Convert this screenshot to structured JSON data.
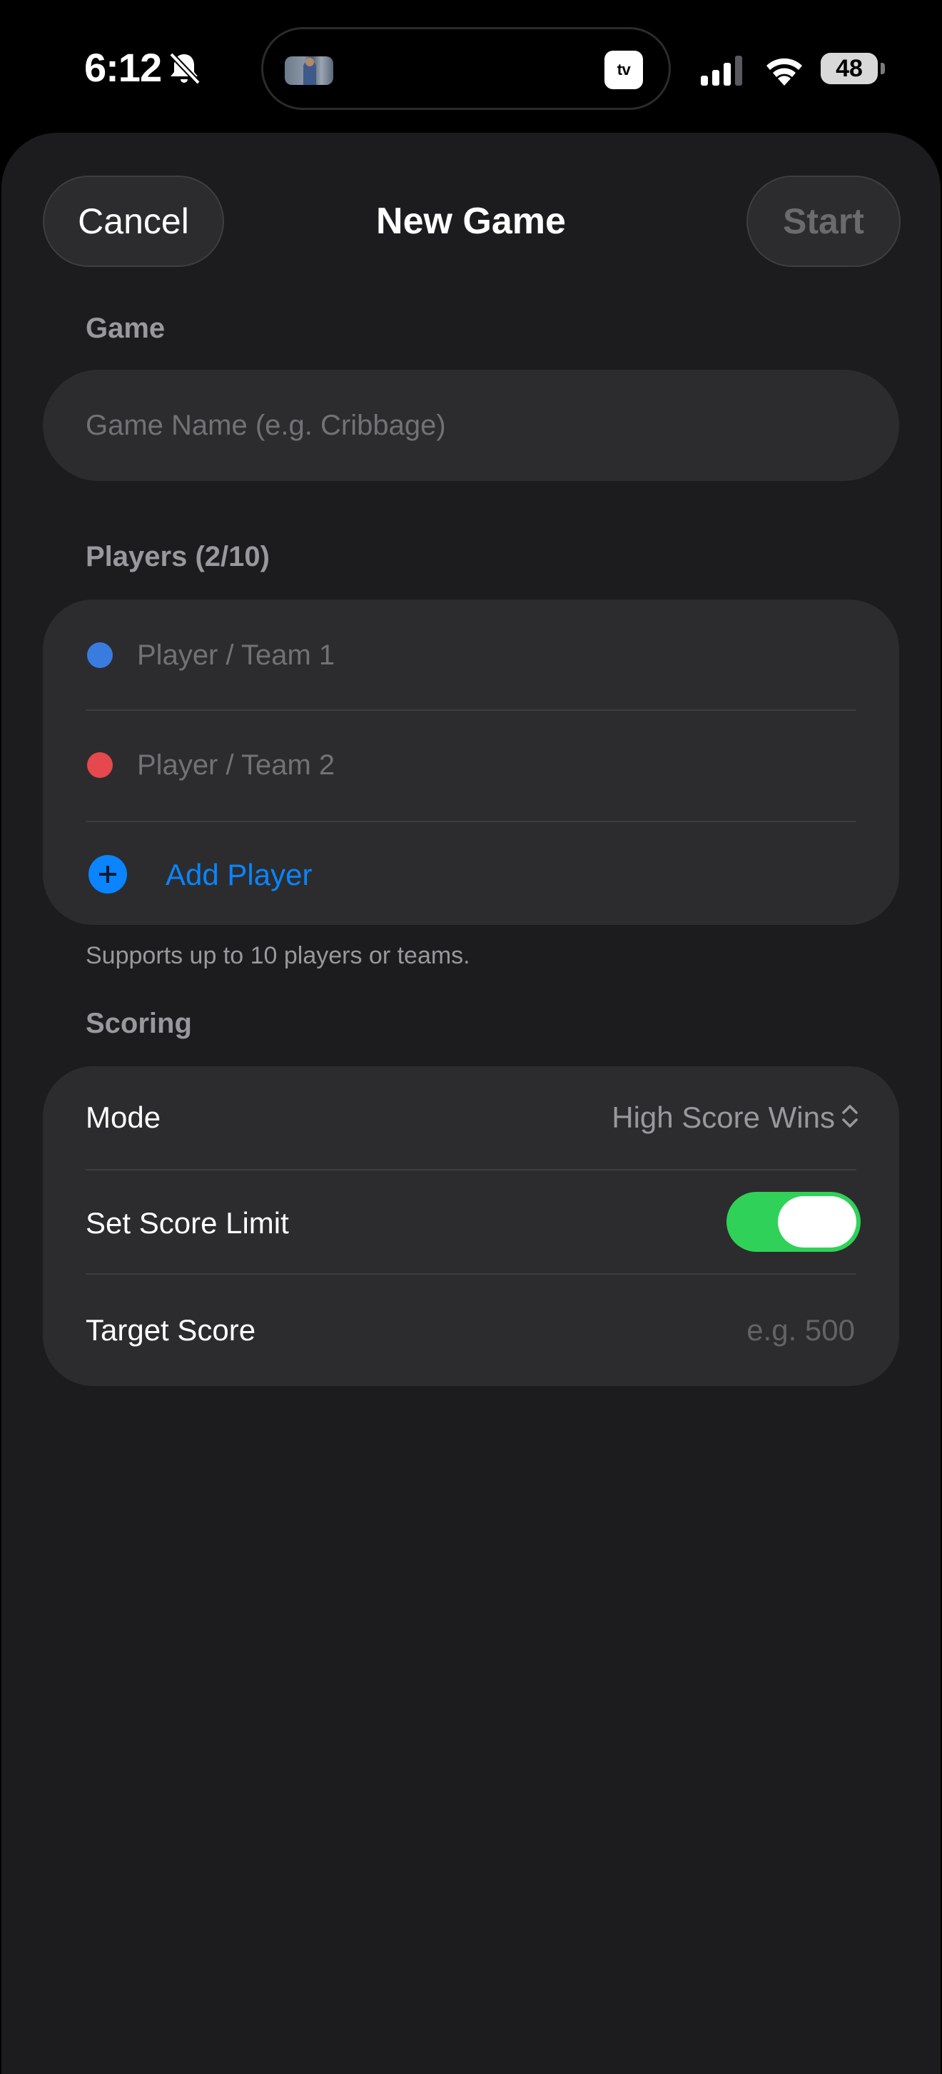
{
  "status_bar": {
    "time": "6:12",
    "battery_level": "48",
    "tv_badge": "tv",
    "icons": [
      "bell-slash-icon",
      "apple-tv-icon",
      "cellular-signal-icon",
      "wifi-icon",
      "battery-icon"
    ]
  },
  "nav": {
    "cancel_label": "Cancel",
    "title": "New Game",
    "start_label": "Start"
  },
  "game_section": {
    "header": "Game",
    "name_placeholder": "Game Name (e.g. Cribbage)"
  },
  "players_section": {
    "header": "Players (2/10)",
    "players": [
      {
        "placeholder": "Player / Team 1",
        "color": "#3a7be0"
      },
      {
        "placeholder": "Player / Team 2",
        "color": "#e5484d"
      }
    ],
    "add_label": "Add Player",
    "footnote": "Supports up to 10 players or teams."
  },
  "scoring_section": {
    "header": "Scoring",
    "mode_label": "Mode",
    "mode_value": "High Score Wins",
    "score_limit_label": "Set Score Limit",
    "score_limit_on": true,
    "target_label": "Target Score",
    "target_placeholder": "e.g. 500"
  },
  "colors": {
    "accent": "#0a84ff",
    "toggle_on": "#30d158",
    "sheet_bg": "#1c1c1e",
    "group_bg": "#2c2c2e"
  }
}
